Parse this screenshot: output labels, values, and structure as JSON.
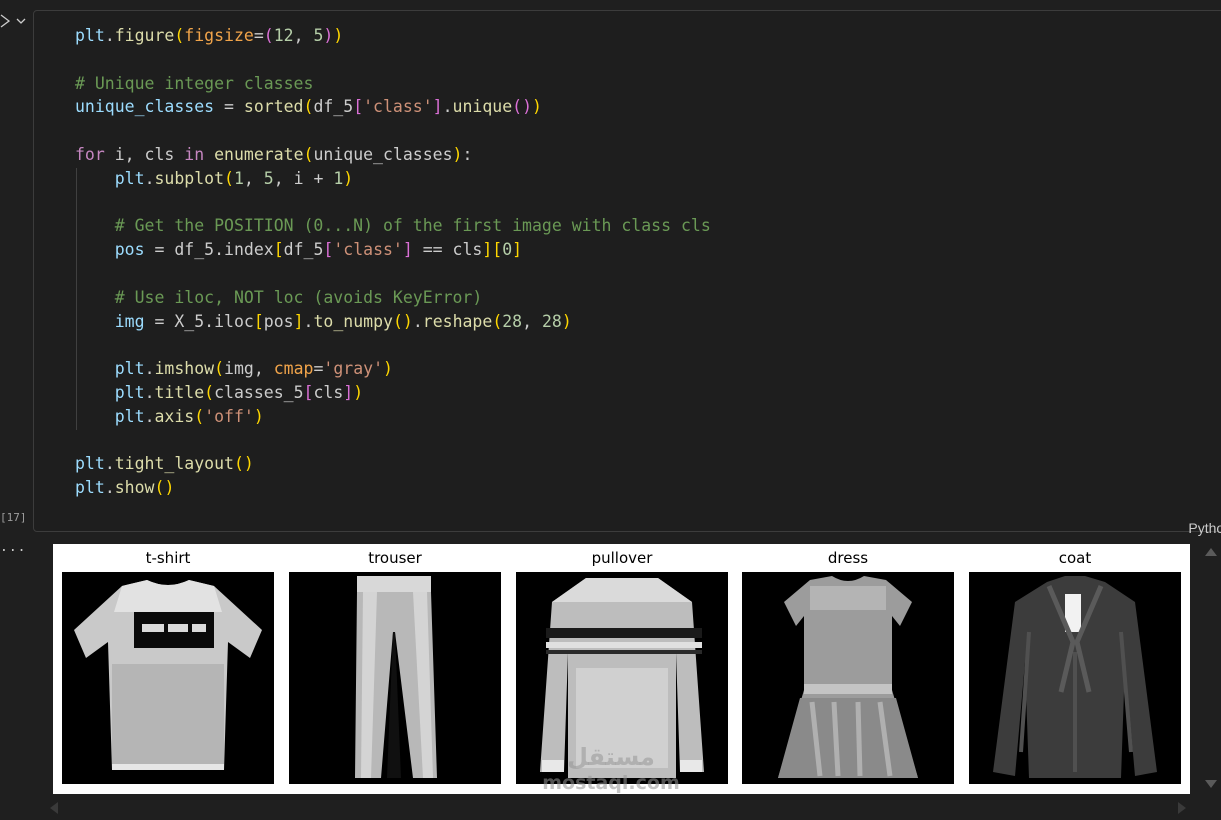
{
  "cell": {
    "execution_count": "[17]",
    "language": "Python",
    "output_marker": "...",
    "code_lines": [
      "plt.figure(figsize=(12, 5))",
      "",
      "# Unique integer classes",
      "unique_classes = sorted(df_5['class'].unique())",
      "",
      "for i, cls in enumerate(unique_classes):",
      "    plt.subplot(1, 5, i + 1)",
      "",
      "    # Get the POSITION (0...N) of the first image with class cls",
      "    pos = df_5.index[df_5['class'] == cls][0]",
      "",
      "    # Use iloc, NOT loc (avoids KeyError)",
      "    img = X_5.iloc[pos].to_numpy().reshape(28, 28)",
      "",
      "    plt.imshow(img, cmap='gray')",
      "    plt.title(classes_5[cls])",
      "    plt.axis('off')",
      "",
      "plt.tight_layout()",
      "plt.show()"
    ]
  },
  "output": {
    "panels": [
      {
        "title": "t-shirt",
        "icon": "t-shirt-image"
      },
      {
        "title": "trouser",
        "icon": "trouser-image"
      },
      {
        "title": "pullover",
        "icon": "pullover-image"
      },
      {
        "title": "dress",
        "icon": "dress-image"
      },
      {
        "title": "coat",
        "icon": "coat-image"
      }
    ]
  },
  "watermark": {
    "arabic": "مستقل",
    "latin": "mostaql.com"
  },
  "colors": {
    "editor_bg": "#1e1e1e",
    "function": "#dcdcaa",
    "variable": "#9cdcfe",
    "keyword": "#c586c0",
    "string": "#ce9178",
    "number": "#b5cea8",
    "comment": "#6a9955"
  }
}
